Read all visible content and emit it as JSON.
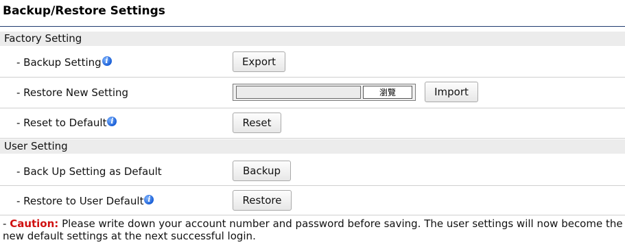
{
  "page": {
    "title": "Backup/Restore Settings"
  },
  "factory": {
    "header": "Factory Setting",
    "backup": {
      "label": "- Backup Setting",
      "button": "Export"
    },
    "restore": {
      "label": "- Restore New Setting",
      "browse": "瀏覽",
      "button": "Import"
    },
    "reset": {
      "label": "- Reset to Default",
      "button": "Reset"
    }
  },
  "user": {
    "header": "User Setting",
    "backup_default": {
      "label": "- Back Up Setting as Default",
      "button": "Backup"
    },
    "restore_default": {
      "label": "- Restore to User Default",
      "button": "Restore"
    }
  },
  "caution": {
    "prefix": "- ",
    "word": "Caution:",
    "text": " Please write down your account number and password before saving. The user settings will now become the new default settings at the next successful login."
  },
  "icons": {
    "info": "info-icon"
  },
  "colors": {
    "title_rule": "#1e3a6e",
    "caution": "#d01010",
    "section_bg": "#ececec"
  }
}
